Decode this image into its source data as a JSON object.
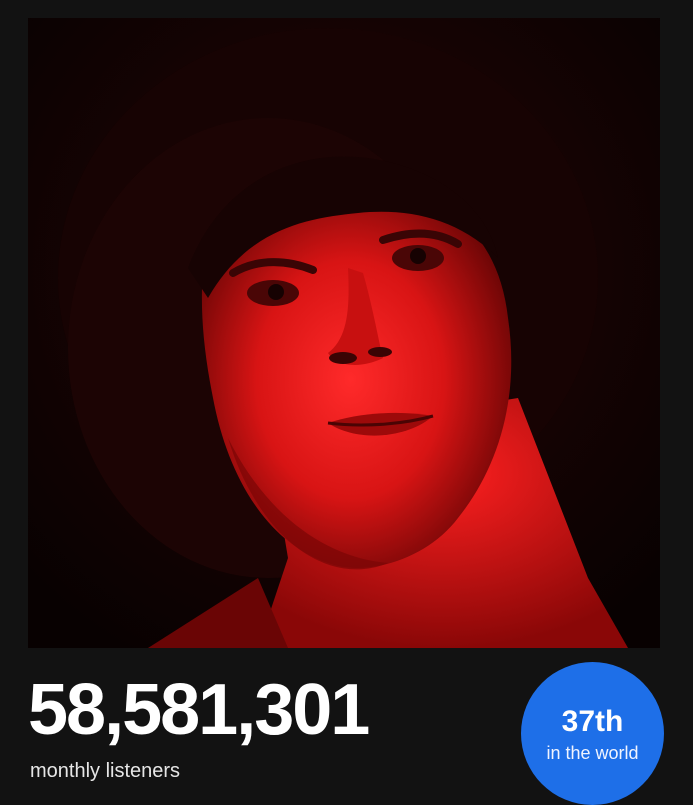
{
  "stats": {
    "monthly_listeners": "58,581,301",
    "monthly_listeners_label": "monthly listeners"
  },
  "rank": {
    "value": "37th",
    "label": "in the world"
  },
  "colors": {
    "background": "#121212",
    "badge": "#1e6fe8",
    "photo_tint": "#d41010"
  },
  "image": {
    "subject": "artist-portrait-red-light"
  }
}
